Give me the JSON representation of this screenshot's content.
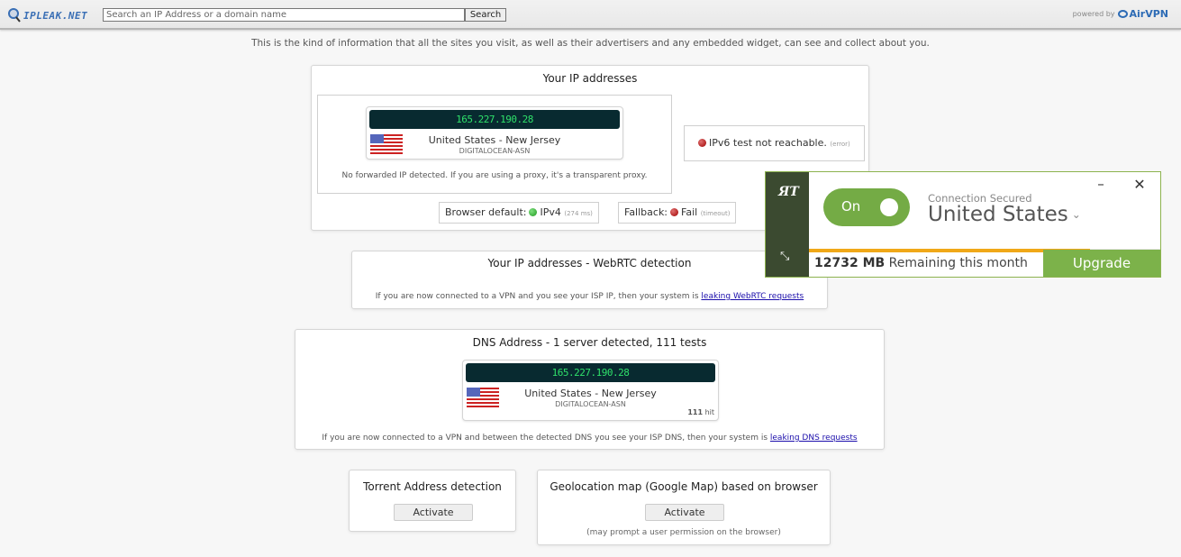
{
  "header": {
    "logo_text": "IPLEAK.NET",
    "search_placeholder": "Search an IP Address or a domain name",
    "search_button": "Search",
    "powered_by": "powered by",
    "brand": "AirVPN"
  },
  "intro": "This is the kind of information that all the sites you visit, as well as their advertisers and any embedded widget, can see and collect about you.",
  "ip_section": {
    "title": "Your IP addresses",
    "ip": "165.227.190.28",
    "location": "United States - New Jersey",
    "asn": "DIGITALOCEAN-ASN",
    "flag": "us-flag-icon",
    "forwarded_note": "No forwarded IP detected. If you are using a proxy, it's a transparent proxy.",
    "ipv6_status": "IPv6 test not reachable.",
    "ipv6_detail": "(error)",
    "browser_default_label": "Browser default:",
    "browser_default_value": "IPv4",
    "browser_default_time": "(274 ms)",
    "fallback_label": "Fallback:",
    "fallback_value": "Fail",
    "fallback_detail": "(timeout)",
    "status_colors": {
      "ok": "#22aa22",
      "fail": "#aa0000"
    }
  },
  "webrtc_section": {
    "title": "Your IP addresses - WebRTC detection",
    "note": "If you are now connected to a VPN and you see your ISP IP, then your system is",
    "link": "leaking WebRTC requests"
  },
  "dns_section": {
    "title": "DNS Address - 1 server detected, 111 tests",
    "ip": "165.227.190.28",
    "location": "United States - New Jersey",
    "asn": "DIGITALOCEAN-ASN",
    "hits_count": "111",
    "hits_label": "hit",
    "note": "If you are now connected to a VPN and between the detected DNS you see your ISP DNS, then your system is",
    "link": "leaking DNS requests"
  },
  "torrent_section": {
    "title": "Torrent Address detection",
    "button": "Activate"
  },
  "geo_section": {
    "title": "Geolocation map (Google Map) based on browser",
    "button": "Activate",
    "note": "(may prompt a user permission on the browser)"
  },
  "vpn_widget": {
    "toggle_label": "On",
    "toggle_on": true,
    "status": "Connection Secured",
    "country": "United States",
    "remaining_amount": "12732 MB",
    "remaining_label": "Remaining this month",
    "usage_fraction": 0.8,
    "upgrade_button": "Upgrade",
    "accent_color": "#74ab45",
    "usage_color": "#f0a818"
  }
}
